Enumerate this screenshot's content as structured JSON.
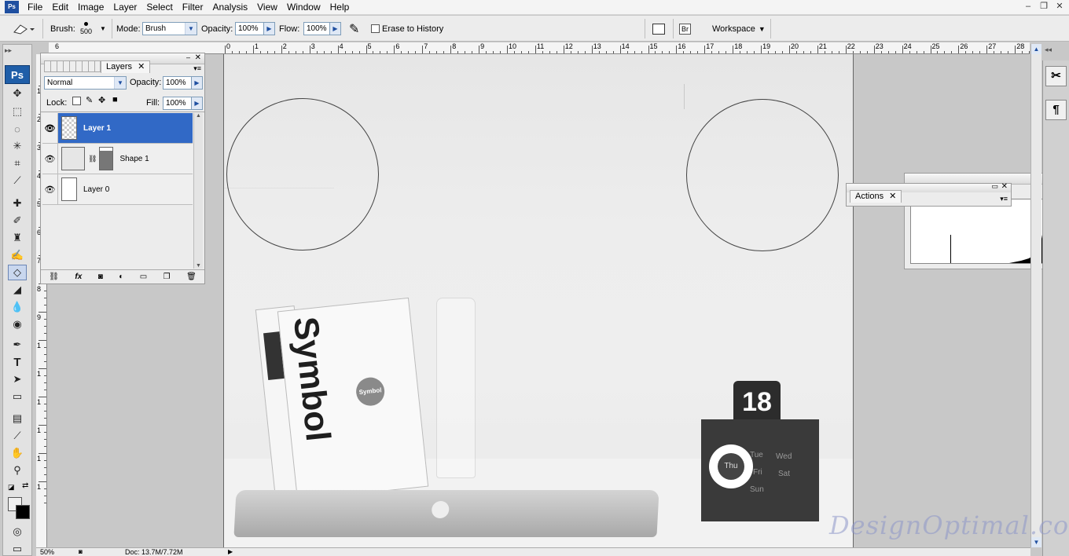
{
  "menu": [
    "File",
    "Edit",
    "Image",
    "Layer",
    "Select",
    "Filter",
    "Analysis",
    "View",
    "Window",
    "Help"
  ],
  "options": {
    "brush_label": "Brush:",
    "brush_size": "500",
    "mode_label": "Mode:",
    "mode_value": "Brush",
    "opacity_label": "Opacity:",
    "opacity_value": "100%",
    "flow_label": "Flow:",
    "flow_value": "100%",
    "erase_history_label": "Erase to History",
    "workspace_label": "Workspace"
  },
  "ruler_top": [
    "6",
    "0",
    "1",
    "2",
    "3",
    "4",
    "5",
    "6",
    "7",
    "8",
    "9",
    "10",
    "11",
    "12",
    "13",
    "14",
    "15",
    "16",
    "17",
    "18",
    "19",
    "20",
    "21",
    "22",
    "23",
    "24",
    "25",
    "26",
    "27",
    "28"
  ],
  "ruler_left": [
    "1",
    "2",
    "3",
    "4",
    "5",
    "6",
    "7",
    "8",
    "9",
    "1",
    "1",
    "1",
    "1",
    "1",
    "1"
  ],
  "layers_panel": {
    "tab_label": "Layers",
    "blend_mode": "Normal",
    "opacity_label": "Opacity:",
    "opacity_value": "100%",
    "lock_label": "Lock:",
    "fill_label": "Fill:",
    "fill_value": "100%",
    "layers": [
      {
        "name": "Layer 1",
        "selected": true
      },
      {
        "name": "Shape 1",
        "selected": false
      },
      {
        "name": "Layer 0",
        "selected": false
      }
    ]
  },
  "actions_panel": {
    "tab_label": "Actions"
  },
  "statusbar": {
    "zoom": "50%",
    "doc": "Doc: 13.7M/7.72M"
  },
  "photo": {
    "book_title": "Symbol",
    "book_sticker": "Symbol",
    "calendar_date": "18",
    "calendar_center_day": "Thu",
    "calendar_days": [
      "Tue",
      "Wed",
      "Fri",
      "Sat",
      "Sun"
    ]
  },
  "watermark": "DesignOptimal.com",
  "logo_text": "Ps",
  "app_icon_text": "Ps"
}
